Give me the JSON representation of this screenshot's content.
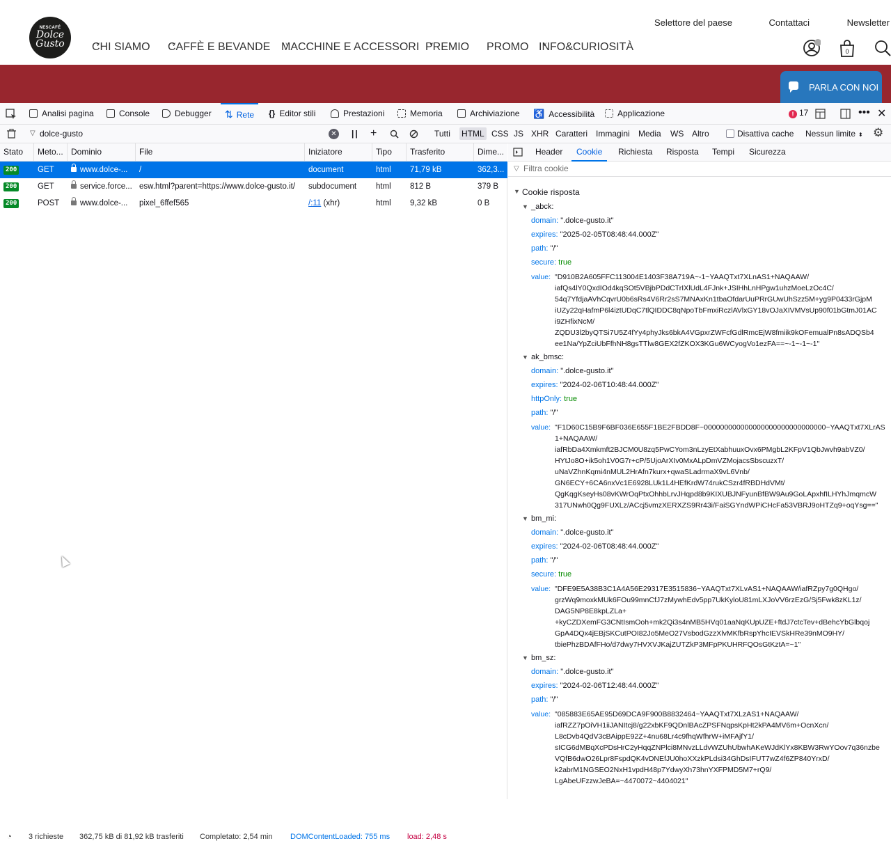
{
  "site": {
    "logo": {
      "brand_top": "NESCAFÉ",
      "brand_line1": "Dolce",
      "brand_line2": "Gusto"
    },
    "top_links": [
      "Selettore del paese",
      "Contattaci",
      "Newsletter"
    ],
    "nav": [
      "CHI SIAMO",
      "CAFFÈ E BEVANDE",
      "MACCHINE E ACCESSORI",
      "PREMIO",
      "PROMO",
      "INFO&CURIOSITÀ"
    ],
    "cart_count": "0",
    "chat_button": "PARLA CON NOI",
    "colors": {
      "banner": "#98262e",
      "chat": "#2877bd"
    }
  },
  "devtools": {
    "tabs": [
      "Analisi pagina",
      "Console",
      "Debugger",
      "Rete",
      "Editor stili",
      "Prestazioni",
      "Memoria",
      "Archiviazione",
      "Accessibilità",
      "Applicazione"
    ],
    "selected_tab": "Rete",
    "error_count": "17",
    "filter_value": "dolce-gusto",
    "type_filters": [
      "Tutti",
      "HTML",
      "CSS",
      "JS",
      "XHR",
      "Caratteri",
      "Immagini",
      "Media",
      "WS",
      "Altro"
    ],
    "selected_type": "HTML",
    "disable_cache": "Disattiva cache",
    "throttle": "Nessun limite",
    "columns": [
      "Stato",
      "Meto...",
      "Dominio",
      "File",
      "Iniziatore",
      "Tipo",
      "Trasferito",
      "Dime..."
    ],
    "requests": [
      {
        "status": "200",
        "method": "GET",
        "domain": "www.dolce-...",
        "file": "/",
        "initiator": "document",
        "initiator_extra": "",
        "type": "html",
        "transferred": "71,79 kB",
        "size": "362,3..."
      },
      {
        "status": "200",
        "method": "GET",
        "domain": "service.force...",
        "file": "esw.html?parent=https://www.dolce-gusto.it/",
        "initiator": "subdocument",
        "initiator_extra": "",
        "type": "html",
        "transferred": "812 B",
        "size": "379 B"
      },
      {
        "status": "200",
        "method": "POST",
        "domain": "www.dolce-...",
        "file": "pixel_6ffef565",
        "initiator": "/:11",
        "initiator_extra": "(xhr)",
        "type": "html",
        "transferred": "9,32 kB",
        "size": "0 B"
      }
    ],
    "status_bar": {
      "requests": "3 richieste",
      "transferred": "362,75 kB di 81,92 kB trasferiti",
      "finish": "Completato: 2,54 min",
      "dcl": "DOMContentLoaded: 755 ms",
      "load": "load: 2,48 s"
    },
    "side_tabs": [
      "Header",
      "Cookie",
      "Richiesta",
      "Risposta",
      "Tempi",
      "Sicurezza"
    ],
    "side_selected": "Cookie",
    "cookie_filter_placeholder": "Filtra cookie",
    "cookie_section": "Cookie risposta",
    "cookies": [
      {
        "name": "_abck:",
        "props": [
          {
            "k": "domain:",
            "v": "\".dolce-gusto.it\"",
            "bool": false
          },
          {
            "k": "expires:",
            "v": "\"2025-02-05T08:48:44.000Z\"",
            "bool": false
          },
          {
            "k": "path:",
            "v": "\"/\"",
            "bool": false
          },
          {
            "k": "secure:",
            "v": "true",
            "bool": true
          }
        ],
        "value_label": "value:",
        "value_lines": [
          "\"D910B2A605FFC113004E1403F38A719A~-1~YAAQTxt7XLnAS1+NAQAAW/",
          "iafQs4lY0QxdIOd4kqSOt5VBjbPDdCTrIXlUdL4FJnk+JSIHhLnHPgw1uhzMoeLzOc4C/",
          "54q7YfdjaAVhCqvrU0b6sRs4V6Rr2sS7MNAxKn1tbaOfdarUuPRrGUwUhSzz5M+yg9P0433rGjpM",
          "iUZy22qHafmP6l4iztUDqC7tlQIDDC8qNpoTbFmxiRczlAVlxGY18vOJaXIVMVsUp90f01bGtmJ01AC",
          "i9ZHfixNcM/",
          "ZQDU3l2byQTSi7U5Z4fYy4phyJks6bkA4VGpxrZWFcfGdlRmcEjW8fmiik9kOFemualPn8sADQSb4",
          "ee1Na/YpZciUbFfhNH8gsTTlw8GEX2fZKOX3KGu6WCyogVo1ezFA==~-1~-1~-1\""
        ]
      },
      {
        "name": "ak_bmsc:",
        "props": [
          {
            "k": "domain:",
            "v": "\".dolce-gusto.it\"",
            "bool": false
          },
          {
            "k": "expires:",
            "v": "\"2024-02-06T10:48:44.000Z\"",
            "bool": false
          },
          {
            "k": "httpOnly:",
            "v": "true",
            "bool": true
          },
          {
            "k": "path:",
            "v": "\"/\"",
            "bool": false
          }
        ],
        "value_label": "value:",
        "value_lines": [
          "\"F1D60C15B9F6BF036E655F1BE2FBDD8F~000000000000000000000000000000~YAAQTxt7XLrAS",
          "1+NAQAAW/",
          "iafRbDa4Xmkmft2BJCM0U8zq5PwCYom3nLzyEtXabhuuxOvx6PMgbL2KFpV1QbJwvh9abVZ0/",
          "HYtJo8O+ik5oh1V0G7r+cP/5UjoArXIv0MxALpDmVZMojacsSbscuzxT/",
          "uNaVZhnKqmi4nMUL2HrAfn7kurx+qwaSLadrmaX9vL6Vnb/",
          "GN6ECY+6CA6nxVc1E6928LUk1L4HEfKrdW74rukCSzr4fRBDHdVMt/",
          "QgKqgKseyHs08vKWrOqPtxOhhbLrvJHqpd8b9KIXUBJNFyunBfBW9Au9GoLApxhfILHYhJmqmcW",
          "317UNwh0Qg9FUXLz/ACcj5vmzXERXZS9Rr43i/FaiSGYndWPiCHcFa53VBRJ9oHTZq9+oqYsg==\""
        ]
      },
      {
        "name": "bm_mi:",
        "props": [
          {
            "k": "domain:",
            "v": "\".dolce-gusto.it\"",
            "bool": false
          },
          {
            "k": "expires:",
            "v": "\"2024-02-06T08:48:44.000Z\"",
            "bool": false
          },
          {
            "k": "path:",
            "v": "\"/\"",
            "bool": false
          },
          {
            "k": "secure:",
            "v": "true",
            "bool": true
          }
        ],
        "value_label": "value:",
        "value_lines": [
          "\"DFE9E5A38B3C1A4A56E29317E3515836~YAAQTxt7XLvAS1+NAQAAW/iafRZpy7g0QHgo/",
          "grzWq9moxkMUk6FOu99mnCfJ7zMywhEdv5pp7UkKyloU81mLXJoVV6rzEzG/Sj5Fwk8zKL1z/",
          "DAG5NP8E8kpLZLa+",
          "+kyCZDXemFG3CNtIsmOoh+mk2Qi3s4nMB5HVq01aaNqKUpUZE+ftdJ7ctcTev+dBehcYbGlbqoj",
          "GpA4DQx4jEBjSKCutPOI82Jo5MeO27VsbodGzzXlvMKfbRspYhcIEVSkHRe39nMO9HY/",
          "tbiePhzBDAfFHo/d7dwy7HVXVJKajZUTZkP3MFpPKUHRFQOsGtKztA=~1\""
        ]
      },
      {
        "name": "bm_sz:",
        "props": [
          {
            "k": "domain:",
            "v": "\".dolce-gusto.it\"",
            "bool": false
          },
          {
            "k": "expires:",
            "v": "\"2024-02-06T12:48:44.000Z\"",
            "bool": false
          },
          {
            "k": "path:",
            "v": "\"/\"",
            "bool": false
          }
        ],
        "value_label": "value:",
        "value_lines": [
          "\"085883E65AE95D69DCA9F900B8832464~YAAQTxt7XLzAS1+NAQAAW/",
          "iafRZZ7pOiVH1iiJANItcj8/g22xbKF9QDnlBAcZPSFNqpsKpHt2kPA4MV6m+OcnXcn/",
          "L8cDvb4QdV3cBAippE92Z+4nu68Lr4c9fhqWfhrW+iMFAjfY1/",
          "sICG6dMBqXcPDsHrC2yHqqZNPlci8MNvzLLdvWZUhUbwhAKeWJdKlYx8KBW3RwYOov7q36nzbe",
          "VQfB6dwO26Lpr8FspdQK4vDNEfJU0hoXXzkPLdsi34GhDsIFUT7wZ4f6ZP840YrxD/",
          "k2abrM1NGSEO2NxH1vpdH48p7YdwyXh73hnYXFPMD5M7+rQ9/",
          "LgAbeUFzzwJeBA=~4470072~4404021\""
        ]
      }
    ]
  }
}
